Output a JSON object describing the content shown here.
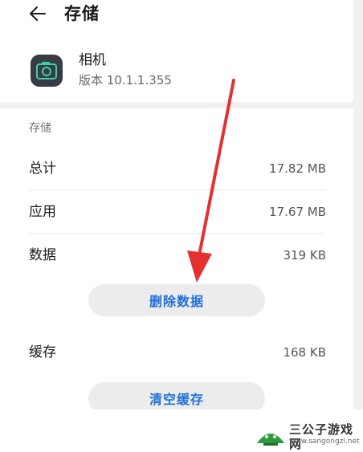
{
  "header": {
    "title": "存储"
  },
  "app": {
    "name": "相机",
    "version": "版本 10.1.1.355"
  },
  "storage": {
    "section_label": "存储",
    "rows": [
      {
        "label": "总计",
        "value": "17.82 MB"
      },
      {
        "label": "应用",
        "value": "17.67 MB"
      },
      {
        "label": "数据",
        "value": "319 KB"
      }
    ],
    "delete_data_label": "删除数据",
    "cache": {
      "label": "缓存",
      "value": "168 KB"
    },
    "clear_cache_label": "清空缓存"
  },
  "watermark": {
    "title": "三公子游戏网",
    "url": "www.sangongzi.net"
  },
  "colors": {
    "accent": "#1f6fd8",
    "annotation_arrow": "#e53030",
    "app_icon": "#363b44",
    "lens": "#3fd0a2"
  }
}
